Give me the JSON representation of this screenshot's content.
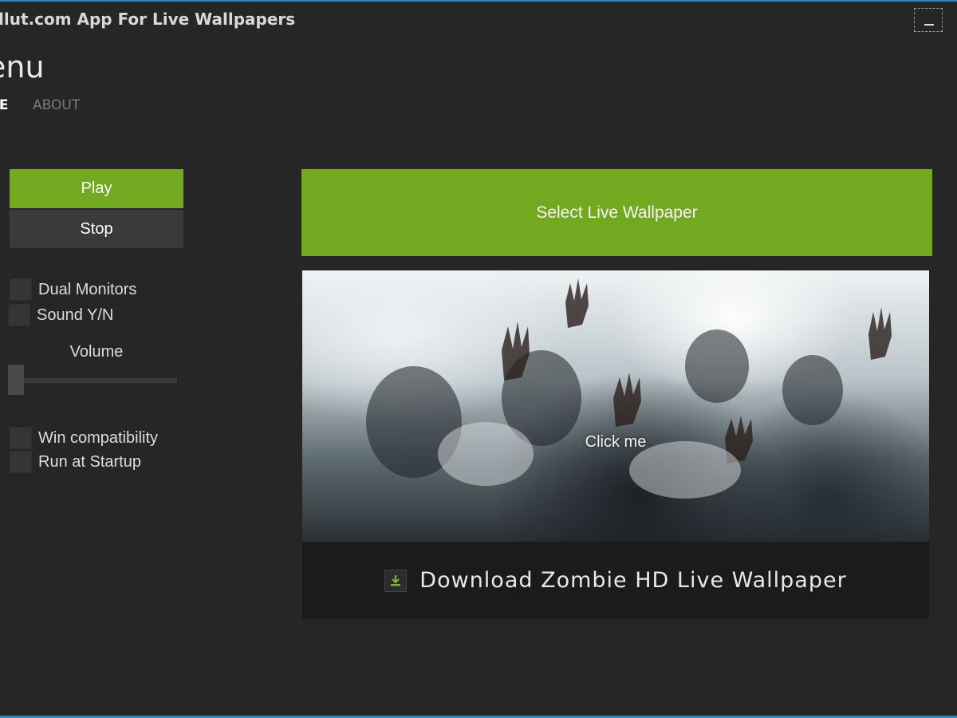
{
  "window": {
    "title": "llut.com App For Live Wallpapers"
  },
  "header": {
    "title": "enu",
    "tabs": [
      {
        "label": "ME",
        "active": true
      },
      {
        "label": "ABOUT",
        "active": false
      }
    ]
  },
  "controls": {
    "play_label": "Play",
    "stop_label": "Stop",
    "options": [
      {
        "label": "Dual Monitors",
        "checked": false
      },
      {
        "label": "Sound Y/N",
        "checked": false
      },
      {
        "label": "Win compatibility",
        "checked": false
      },
      {
        "label": "Run at Startup",
        "checked": false
      }
    ],
    "volume_label": "Volume",
    "volume_level": 0
  },
  "main": {
    "select_label": "Select Live Wallpaper",
    "preview_label": "Click me",
    "download_label": "Download Zombie HD Live Wallpaper",
    "download_icon": "download-icon"
  },
  "colors": {
    "accent_green": "#73a821",
    "background": "#262626",
    "window_border": "#2d89c8"
  }
}
